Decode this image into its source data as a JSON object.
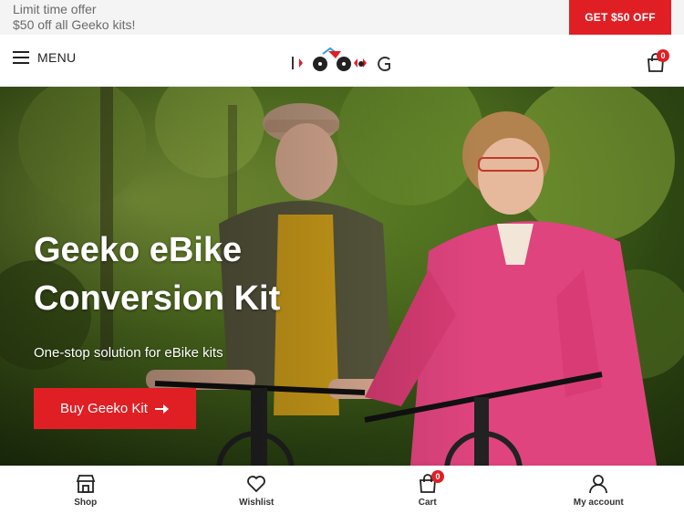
{
  "promo": {
    "line1": "Limit time offer",
    "line2": "$50 off all Geeko kits!",
    "button_label": "GET $50 OFF"
  },
  "header": {
    "menu_label": "MENU",
    "logo_text": "1 G",
    "cart_count": "0"
  },
  "hero": {
    "title_line1": "Geeko eBike",
    "title_line2": "Conversion Kit",
    "subtitle": "One-stop solution for eBike kits",
    "button_label": "Buy Geeko Kit",
    "button_icon": "arrow-right-icon"
  },
  "bottom_nav": {
    "items": [
      {
        "label": "Shop",
        "icon": "shop-icon"
      },
      {
        "label": "Wishlist",
        "icon": "heart-icon"
      },
      {
        "label": "Cart",
        "icon": "cart-icon",
        "badge": "0"
      },
      {
        "label": "My account",
        "icon": "user-icon"
      }
    ]
  },
  "colors": {
    "accent": "#e01f25",
    "promo_bg": "#f4f4f4",
    "logo_blue": "#2a9fd6"
  }
}
